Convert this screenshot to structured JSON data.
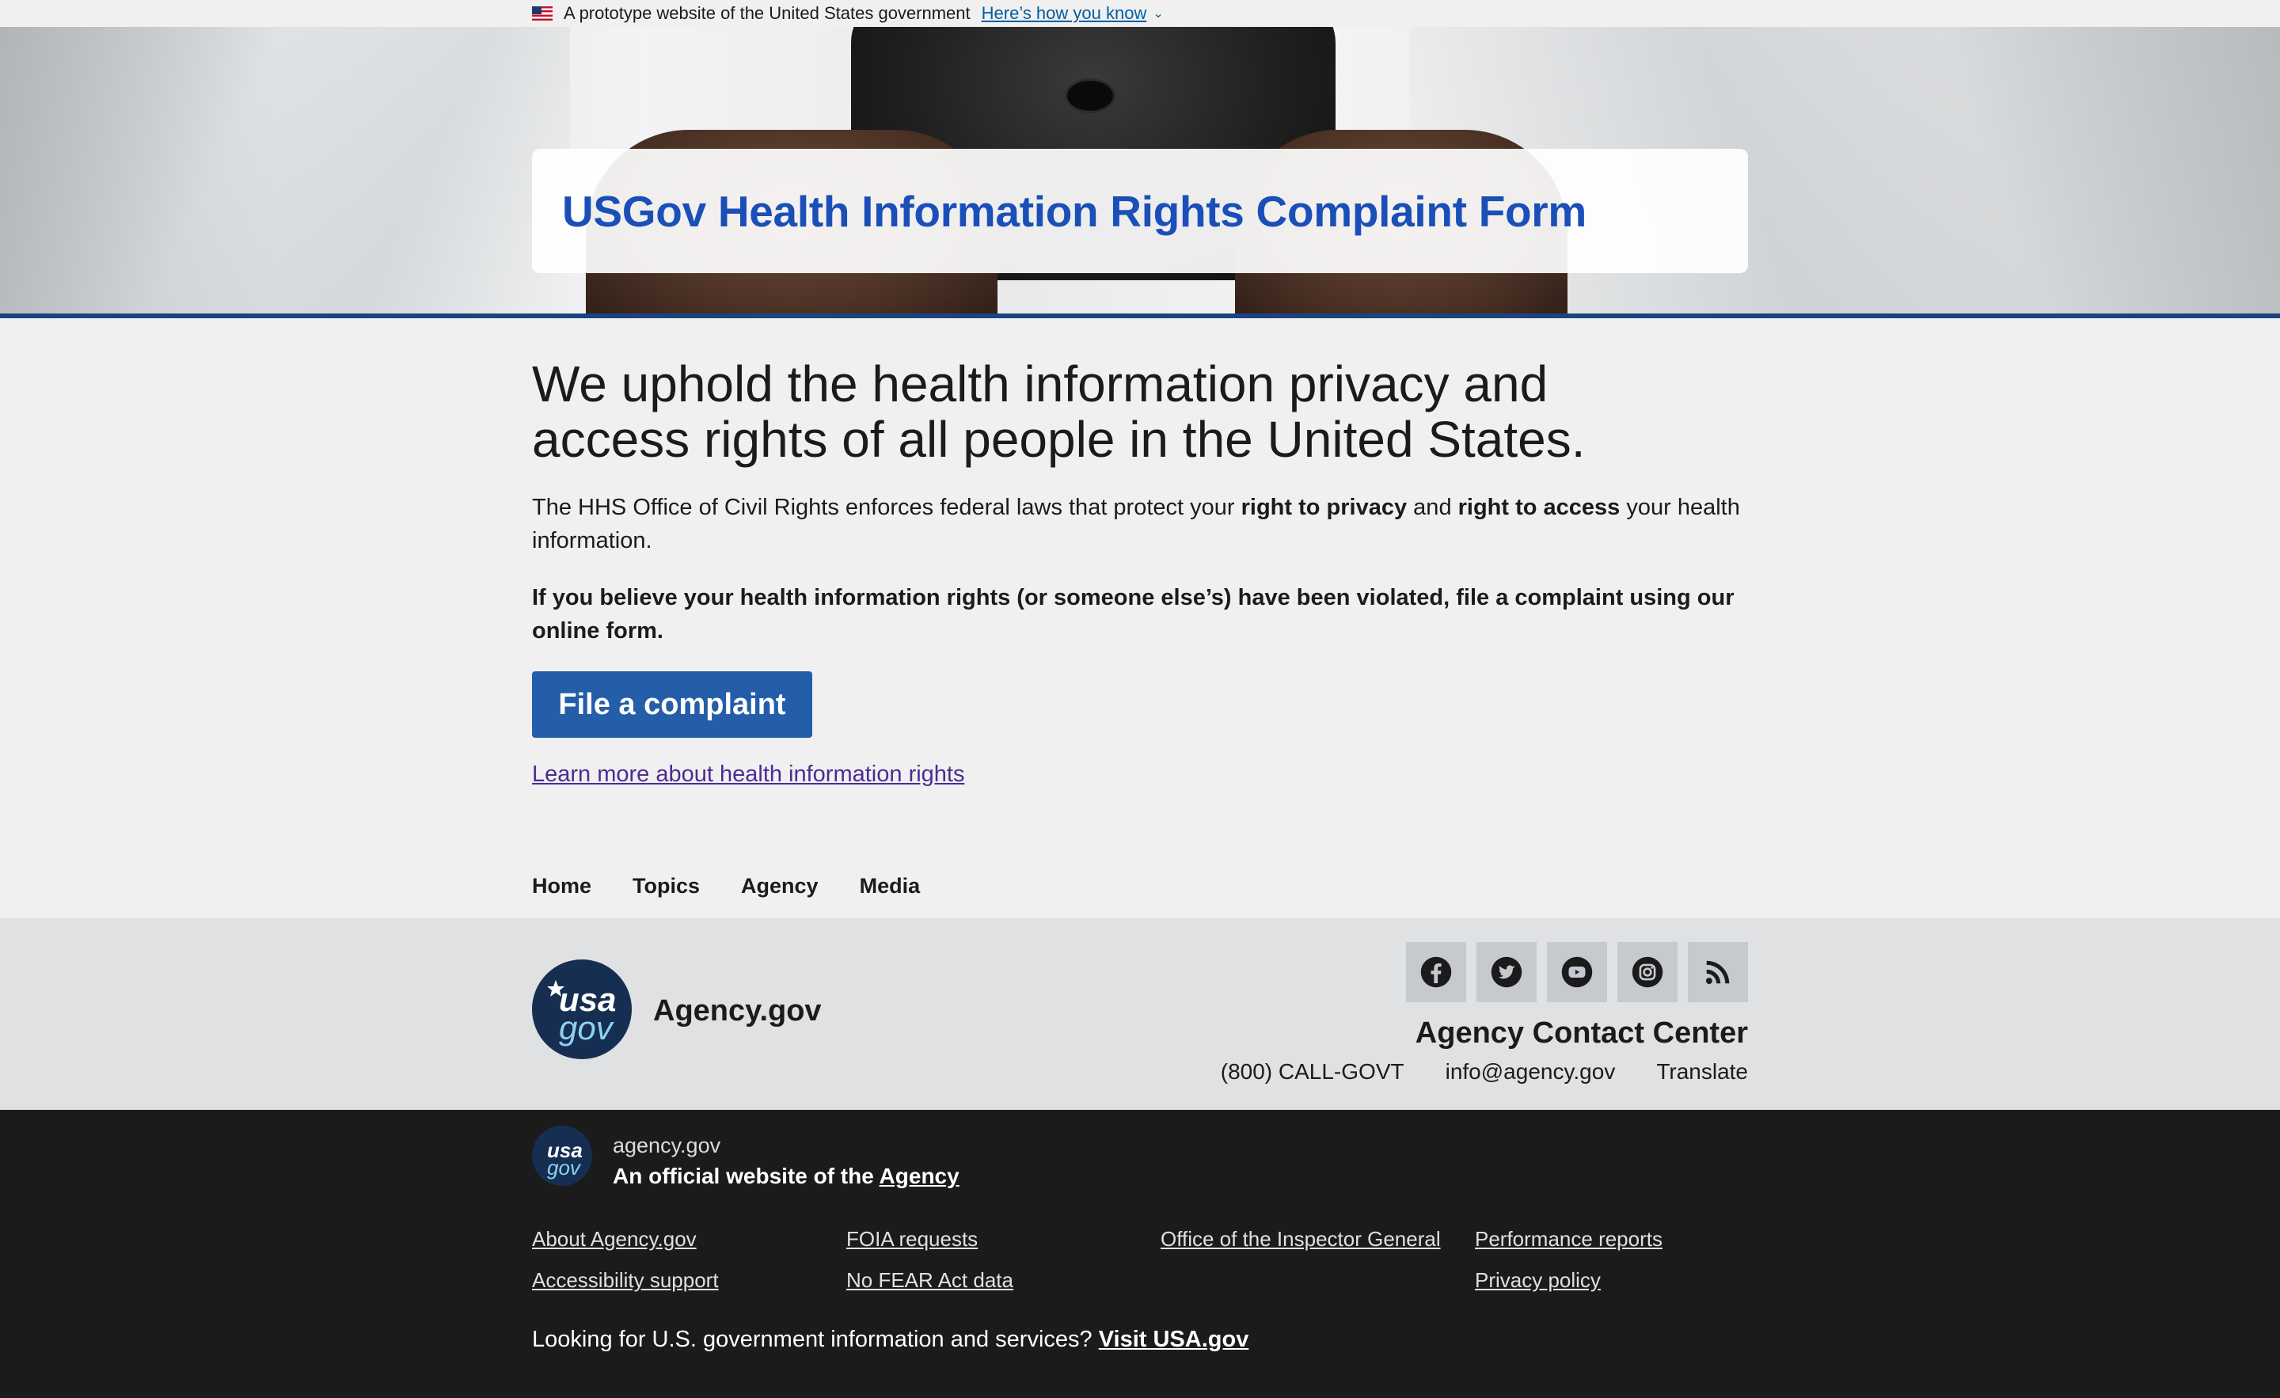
{
  "banner": {
    "text": "A prototype website of the United States government",
    "link": "Here’s how you know"
  },
  "hero": {
    "title": "USGov Health Information Rights Complaint Form"
  },
  "main": {
    "lead": "We uphold the health information privacy and access rights of all people in the United States.",
    "p1_start": "The HHS Office of Civil Rights enforces federal laws that protect your ",
    "p1_bold1": "right to privacy",
    "p1_mid": " and ",
    "p1_bold2": "right to access",
    "p1_end": " your health information.",
    "p2": "If you believe your health information rights (or someone else’s) have been violated, file a complaint using our online form.",
    "button": "File a complaint",
    "learn_link": "Learn more about health information rights"
  },
  "nav": {
    "items": [
      "Home",
      "Topics",
      "Agency",
      "Media"
    ]
  },
  "footer": {
    "logo_usa": "usa",
    "logo_gov": "gov",
    "agency_name": "Agency.gov",
    "social_icons": [
      "facebook-icon",
      "twitter-icon",
      "youtube-icon",
      "instagram-icon",
      "rss-icon"
    ],
    "contact_title": "Agency Contact Center",
    "phone": "(800) CALL-GOVT",
    "email": "info@agency.gov",
    "translate": "Translate"
  },
  "identifier": {
    "domain": "agency.gov",
    "official_prefix": "An official website of the ",
    "official_link": "Agency",
    "links": [
      "About Agency.gov",
      "FOIA requests",
      "Office of the Inspector General",
      "Performance reports",
      "Accessibility support",
      "No FEAR Act data",
      "Privacy policy"
    ],
    "usagov_prefix": "Looking for U.S. government information and services? ",
    "usagov_link": "Visit USA.gov"
  }
}
